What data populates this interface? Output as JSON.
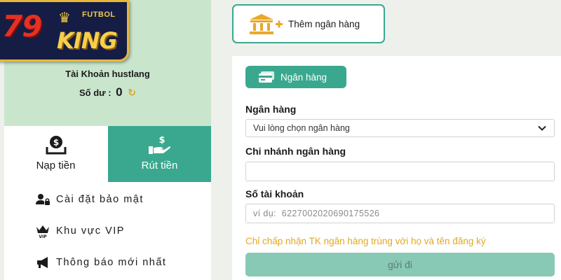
{
  "logo": {
    "number": "79",
    "futbol": "FUTBOL",
    "king": "KING"
  },
  "account": {
    "name": "Tài Khoản hustlang",
    "balance_label": "Số dư :",
    "balance_value": "0"
  },
  "tabs": [
    {
      "label": "Nạp tiền",
      "icon": "money-bag-icon"
    },
    {
      "label": "Rút tiền",
      "icon": "hand-dollar-icon"
    }
  ],
  "menu": [
    {
      "label": "Cài đặt bảo mật",
      "icon": "user-lock-icon"
    },
    {
      "label": "Khu vực VIP",
      "icon": "vip-crown-icon"
    },
    {
      "label": "Thông báo mới nhất",
      "icon": "megaphone-icon"
    }
  ],
  "add_bank": {
    "label": "Thêm ngân hàng",
    "icon": "bank-plus-icon"
  },
  "form": {
    "bank_tab_label": "Ngân hàng",
    "bank_label": "Ngân hàng",
    "bank_select_value": "Vui lòng chọn ngân hàng",
    "branch_label": "Chi nhánh ngân hàng",
    "branch_value": "",
    "account_number_label": "Số tài khoản",
    "account_number_placeholder": "ví dụ:  6227002020690175526",
    "notice": "Chỉ chấp nhận TK ngân hàng trùng với họ và tên đăng ký",
    "submit_label": "gửi đi"
  },
  "colors": {
    "accent": "#3aa88e",
    "account_panel_bg": "#c9e6cd",
    "notice": "#e2a81f",
    "submit_disabled": "#88c9b6",
    "logo_bg": "#151d45",
    "logo_gold": "#f6cf4d",
    "logo_red": "#e63021"
  }
}
